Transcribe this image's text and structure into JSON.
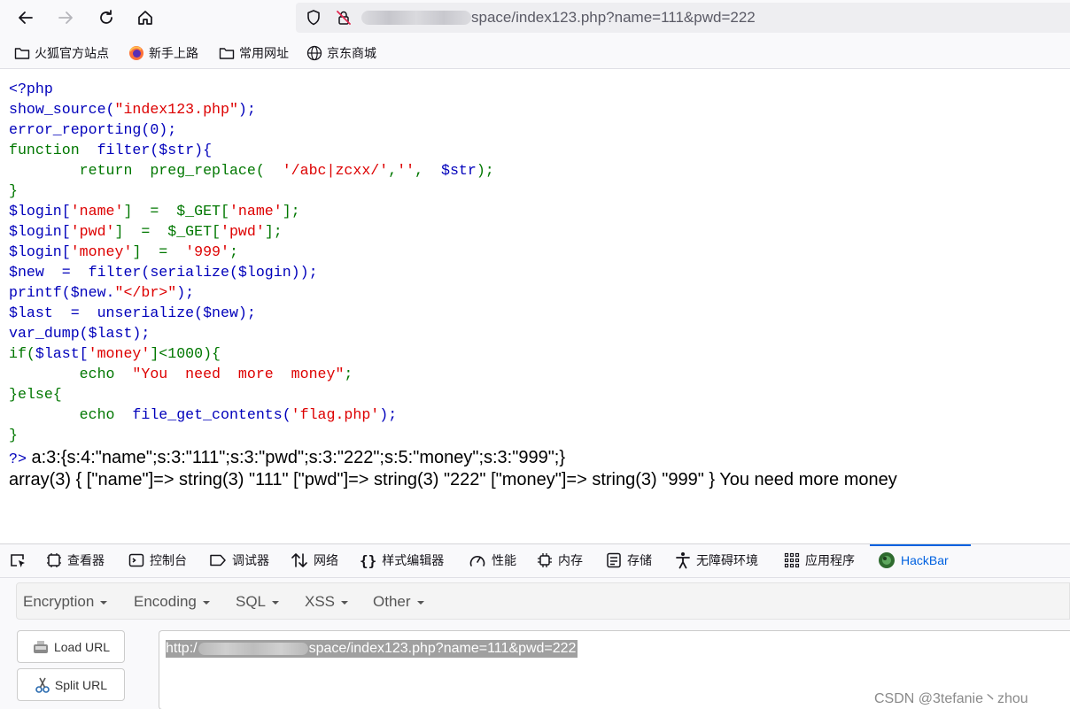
{
  "browser": {
    "url_suffix": "space/index123.php?name=111&pwd=222",
    "bookmarks": [
      "火狐官方站点",
      "新手上路",
      "常用网址",
      "京东商城"
    ]
  },
  "source": {
    "l1": "<?php",
    "l2a": "show_source(",
    "l2b": "\"index123.php\"",
    "l2c": ");",
    "l3": "error_reporting(0);",
    "l4a": "function",
    "l4b": "  filter($str){",
    "l5a": "        ",
    "l5b": "return",
    "l5c": "  preg_replace(  ",
    "l5d": "'/abc|zcxx/'",
    "l5e": ",",
    "l5f": "''",
    "l5g": ",  ",
    "l5h": "$str",
    "l5i": ");",
    "l6": "}",
    "l7a": "$login[",
    "l7b": "'name'",
    "l7c": "]  =  $_GET[",
    "l7d": "'name'",
    "l7e": "];",
    "l8a": "$login[",
    "l8b": "'pwd'",
    "l8c": "]  =  $_GET[",
    "l8d": "'pwd'",
    "l8e": "];",
    "l9a": "$login[",
    "l9b": "'money'",
    "l9c": "]  =  ",
    "l9d": "'999'",
    "l9e": ";",
    "l10a": "$new  =  filter(serialize($login));",
    "l11a": "printf($new.",
    "l11b": "\"</br>\"",
    "l11c": ");",
    "l12": "$last  =  unserialize($new);",
    "l13": "var_dump($last);",
    "l14a": "if(",
    "l14b": "$last[",
    "l14c": "'money'",
    "l14d": "]<1000){",
    "l15a": "        echo  ",
    "l15b": "\"You  need  more  money\"",
    "l15c": ";",
    "l16a": "}else{",
    "l17a": "        echo  ",
    "l17b": "file_get_contents(",
    "l17c": "'flag.php'",
    "l17d": ");",
    "l18": "}",
    "l19": "?>"
  },
  "output": {
    "serialized": "a:3:{s:4:\"name\";s:3:\"111\";s:3:\"pwd\";s:3:\"222\";s:5:\"money\";s:3:\"999\";}",
    "dump": "array(3) { [\"name\"]=> string(3) \"111\" [\"pwd\"]=> string(3) \"222\" [\"money\"]=> string(3) \"999\" } You need more money"
  },
  "devtools": {
    "tabs": [
      "查看器",
      "控制台",
      "调试器",
      "网络",
      "样式编辑器",
      "性能",
      "内存",
      "存储",
      "无障碍环境",
      "应用程序",
      "HackBar"
    ],
    "active_tab": "HackBar"
  },
  "hackbar": {
    "menu": [
      "Encryption",
      "Encoding",
      "SQL",
      "XSS",
      "Other"
    ],
    "load_url": "Load URL",
    "split_url": "Split URL",
    "url_prefix": "http:/",
    "url_suffix": "space/index123.php?name=111&pwd=222"
  },
  "watermark": "CSDN @3tefanie丶zhou",
  "colors": {
    "php_keyword": "#007700",
    "php_string": "#dd0000",
    "php_default": "#0000bb",
    "accent": "#0061e0"
  }
}
